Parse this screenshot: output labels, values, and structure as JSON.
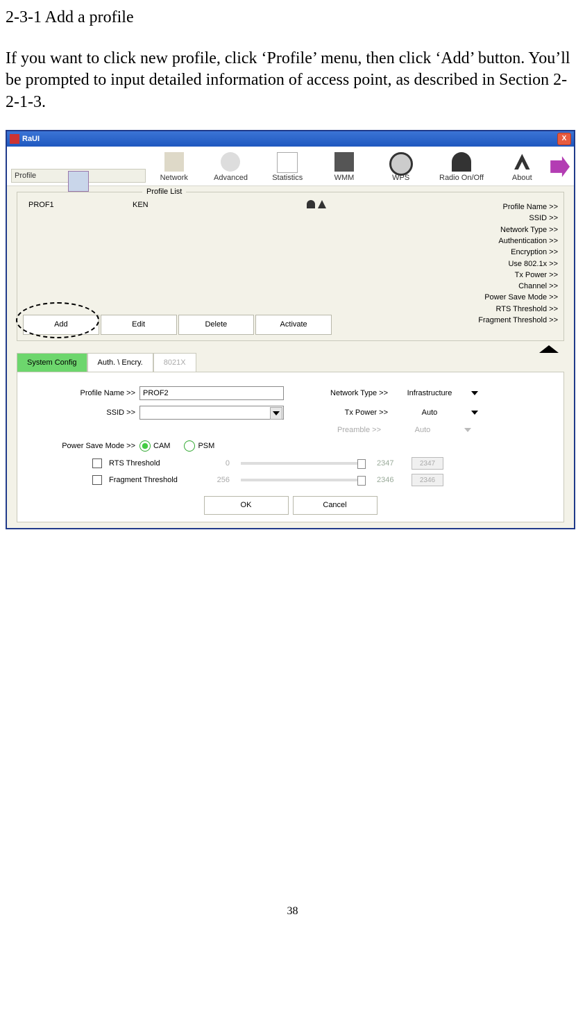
{
  "doc": {
    "heading": "2-3-1 Add a profile",
    "paragraph": "If you want to click new profile, click ‘Profile’ menu, then click ‘Add’ button. You’ll be prompted to input detailed information of access point, as described in Section 2-2-1-3.",
    "page_number": "38"
  },
  "window": {
    "title": "RaUI"
  },
  "toolbar": {
    "items": [
      "Profile",
      "Network",
      "Advanced",
      "Statistics",
      "WMM",
      "WPS",
      "Radio On/Off",
      "About"
    ]
  },
  "profile_list": {
    "legend": "Profile List",
    "rows": [
      {
        "name": "PROF1",
        "ssid": "KEN"
      }
    ],
    "buttons": {
      "add": "Add",
      "edit": "Edit",
      "delete": "Delete",
      "activate": "Activate"
    },
    "details": {
      "profile_name": "Profile Name >>",
      "ssid": "SSID >>",
      "network_type": "Network Type >>",
      "authentication": "Authentication >>",
      "encryption": "Encryption >>",
      "use8021x": "Use 802.1x >>",
      "txpower": "Tx Power >>",
      "channel": "Channel >>",
      "psm": "Power Save Mode >>",
      "rts": "RTS Threshold >>",
      "frag": "Fragment Threshold >>"
    }
  },
  "tabs": {
    "system_config": "System Config",
    "auth_encry": "Auth. \\ Encry.",
    "x8021": "8021X"
  },
  "config": {
    "labels": {
      "profile_name": "Profile Name >>",
      "ssid": "SSID >>",
      "network_type": "Network Type >>",
      "txpower": "Tx Power >>",
      "preamble": "Preamble >>",
      "psm": "Power Save Mode >>",
      "cam": "CAM",
      "psm_opt": "PSM",
      "rts": "RTS Threshold",
      "frag": "Fragment Threshold"
    },
    "values": {
      "profile_name": "PROF2",
      "ssid": "",
      "network_type": "Infrastructure",
      "txpower": "Auto",
      "preamble": "Auto",
      "rts_min": "0",
      "rts_max": "2347",
      "rts_val": "2347",
      "frag_min": "256",
      "frag_max": "2346",
      "frag_val": "2346"
    },
    "buttons": {
      "ok": "OK",
      "cancel": "Cancel"
    }
  }
}
